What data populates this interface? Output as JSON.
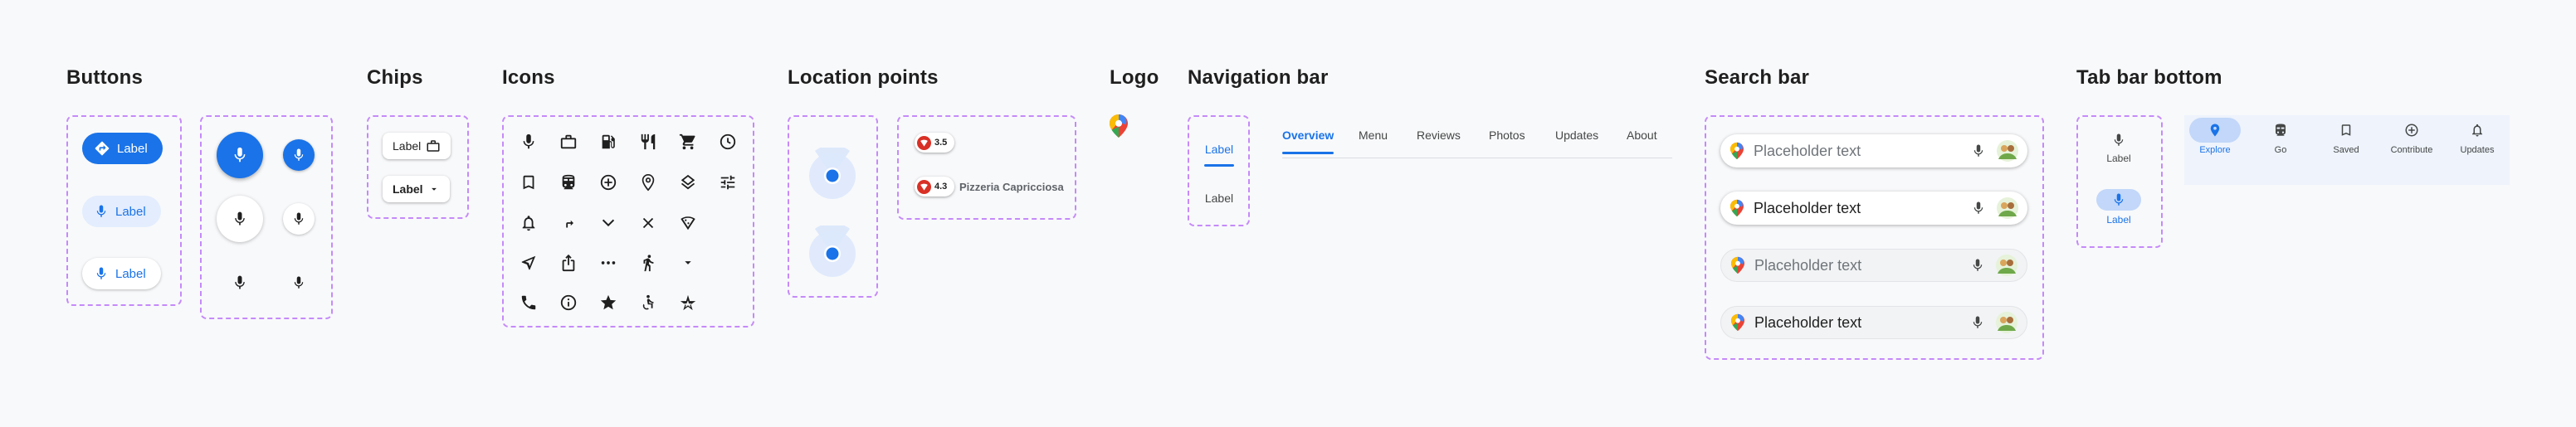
{
  "sections": {
    "buttons": "Buttons",
    "chips": "Chips",
    "icons": "Icons",
    "location_points": "Location points",
    "logo": "Logo",
    "navigation_bar": "Navigation bar",
    "search_bar": "Search bar",
    "tab_bar_bottom": "Tab bar bottom"
  },
  "buttons": {
    "filled_label": "Label",
    "tonal_label": "Label",
    "outlined_label": "Label"
  },
  "chips": {
    "chip1_label": "Label",
    "chip2_label": "Label"
  },
  "icons": [
    "microphone-icon",
    "work-icon",
    "local-gas-station-icon",
    "restaurant-icon",
    "shopping-cart-icon",
    "schedule-icon",
    "bookmark-icon",
    "directions-transit-icon",
    "add-circle-icon",
    "location-pin-icon",
    "layers-icon",
    "tune-icon",
    "notifications-icon",
    "turn-right-icon",
    "chevron-down-icon",
    "close-icon",
    "pizza-icon",
    "navigation-icon",
    "share-icon",
    "more-horiz-icon",
    "directions-walk-icon",
    "dropdown-arrow-icon",
    "phone-icon",
    "info-icon",
    "star-icon",
    "accessible-icon",
    "star-rate-icon"
  ],
  "location_points": {
    "rating1": "3.5",
    "rating2": "4.3",
    "place_name": "Pizzeria Capricciosa"
  },
  "navigation_bar": {
    "vertical_tabs": [
      "Label",
      "Label"
    ],
    "tabs": [
      "Overview",
      "Menu",
      "Reviews",
      "Photos",
      "Updates",
      "About"
    ],
    "active_tab": "Overview"
  },
  "search_bar": {
    "placeholder": "Placeholder text"
  },
  "tab_bar_bottom": {
    "vertical_items": [
      "Label",
      "Label"
    ],
    "items": [
      "Explore",
      "Go",
      "Saved",
      "Contribute",
      "Updates"
    ],
    "active_item": "Explore"
  },
  "colors": {
    "accent": "#1a73e8",
    "tonal": "#e3edfd",
    "dash": "#c58af9",
    "rating_red": "#d93025"
  }
}
